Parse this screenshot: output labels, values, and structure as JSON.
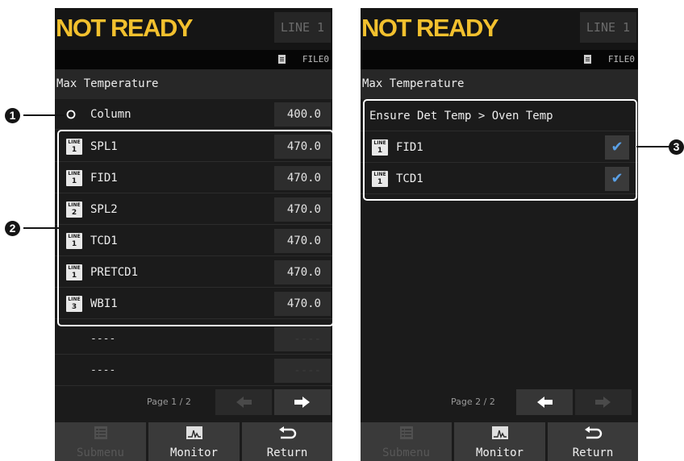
{
  "left": {
    "status": "NOT READY",
    "line_button": "LINE 1",
    "file_label": "FILE0",
    "title": "Max Temperature",
    "column": {
      "label": "Column",
      "value": "400.0"
    },
    "rows": [
      {
        "line": "1",
        "label": "SPL1",
        "value": "470.0"
      },
      {
        "line": "1",
        "label": "FID1",
        "value": "470.0"
      },
      {
        "line": "2",
        "label": "SPL2",
        "value": "470.0"
      },
      {
        "line": "1",
        "label": "TCD1",
        "value": "470.0"
      },
      {
        "line": "1",
        "label": "PRETCD1",
        "value": "470.0"
      },
      {
        "line": "3",
        "label": "WBI1",
        "value": "470.0"
      }
    ],
    "empty_rows": [
      {
        "label": "----",
        "value": "----"
      },
      {
        "label": "----",
        "value": "----"
      }
    ],
    "page": "Page 1 / 2",
    "submenu": "Submenu",
    "monitor": "Monitor",
    "return": "Return"
  },
  "right": {
    "status": "NOT READY",
    "line_button": "LINE 1",
    "file_label": "FILE0",
    "title": "Max Temperature",
    "ensure_label": "Ensure Det Temp > Oven Temp",
    "rows": [
      {
        "line": "1",
        "label": "FID1",
        "checked": "✔"
      },
      {
        "line": "1",
        "label": "TCD1",
        "checked": "✔"
      }
    ],
    "page": "Page 2 / 2",
    "submenu": "Submenu",
    "monitor": "Monitor",
    "return": "Return"
  },
  "line_icon_text": "LINE",
  "callouts": [
    "1",
    "2",
    "3"
  ],
  "colors": {
    "status": "#f2c02e",
    "check": "#5aa0e6",
    "callout_frame": "#ffffff"
  }
}
